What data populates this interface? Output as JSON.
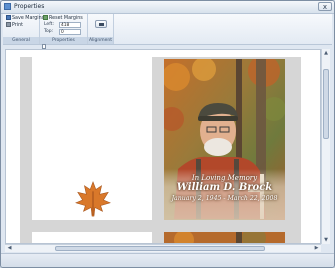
{
  "window": {
    "title": "Properties",
    "close_label": "x"
  },
  "ribbon": {
    "groups": [
      {
        "label": "General"
      },
      {
        "label": "Properties"
      },
      {
        "label": "Alignment"
      }
    ],
    "general": {
      "save_margins_label": "Save Margins",
      "print_label": "Print"
    },
    "properties": {
      "reset_margins_label": "Reset Margins",
      "left_label": "Left:",
      "left_value": "418",
      "top_label": "Top:",
      "top_value": "0"
    }
  },
  "card": {
    "memory_line": "In Loving Memory",
    "name": "William D. Brock",
    "dates": "January 2, 1945 - March 22, 2008"
  },
  "colors": {
    "accent": "#4b79b8",
    "ribbon_label_bg": "#c9d6e6"
  },
  "icons": [
    "save-icon",
    "print-icon",
    "reset-icon",
    "close-icon",
    "align-icon"
  ]
}
